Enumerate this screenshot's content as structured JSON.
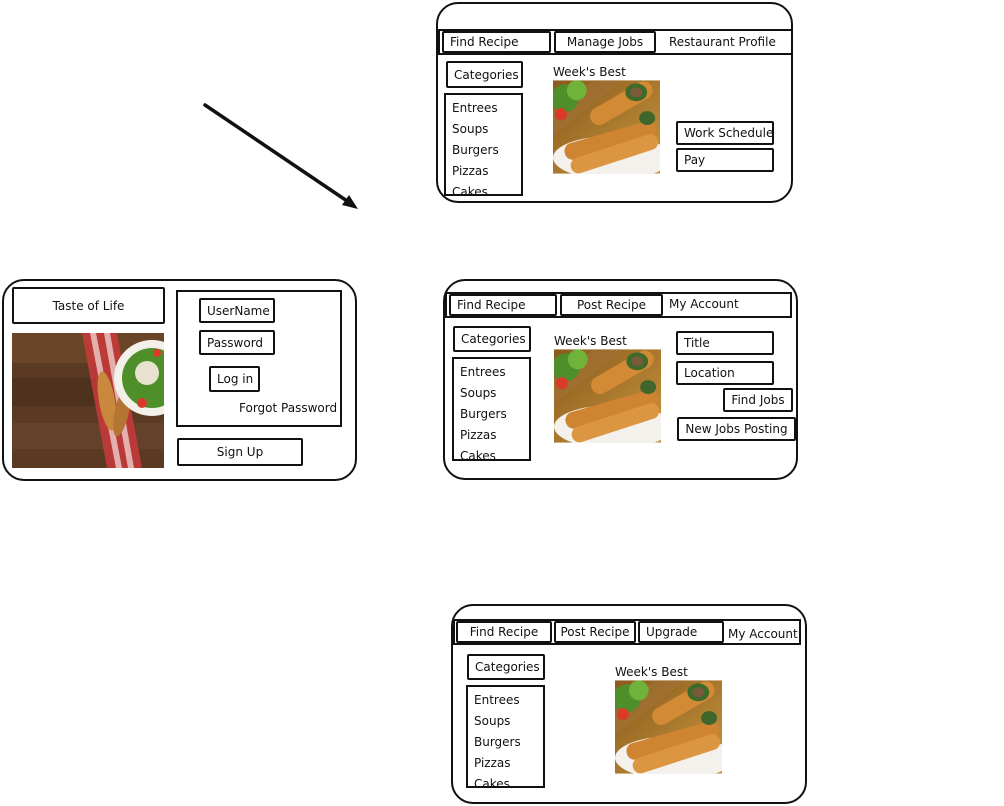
{
  "arrow": {
    "stroke": "#111111"
  },
  "login": {
    "brand": "Taste of Life",
    "username_label": "UserName",
    "password_label": "Password",
    "login_button": "Log in",
    "forgot_link": "Forgot Password",
    "signup_button": "Sign Up",
    "photo_icon": "salad-photo"
  },
  "restaurant": {
    "tabs": [
      "Find Recipe",
      "Manage Jobs",
      "Restaurant Profile"
    ],
    "categories_button": "Categories",
    "categories": [
      "Entrees",
      "Soups",
      "Burgers",
      "Pizzas",
      "Cakes"
    ],
    "featured_label": "Week's Best",
    "featured_icon": "spring-rolls-photo",
    "buttons": [
      "Work Schedule",
      "Pay"
    ]
  },
  "jobseeker": {
    "tabs": [
      "Find Recipe",
      "Post Recipe",
      "My Account"
    ],
    "categories_button": "Categories",
    "categories": [
      "Entrees",
      "Soups",
      "Burgers",
      "Pizzas",
      "Cakes"
    ],
    "featured_label": "Week's Best",
    "featured_icon": "spring-rolls-photo",
    "title_field": "Title",
    "location_field": "Location",
    "find_jobs_button": "Find Jobs",
    "new_jobs_button": "New Jobs Posting"
  },
  "member": {
    "tabs": [
      "Find Recipe",
      "Post Recipe",
      "Upgrade",
      "My Account"
    ],
    "categories_button": "Categories",
    "categories": [
      "Entrees",
      "Soups",
      "Burgers",
      "Pizzas",
      "Cakes"
    ],
    "featured_label": "Week's Best",
    "featured_icon": "spring-rolls-photo"
  }
}
